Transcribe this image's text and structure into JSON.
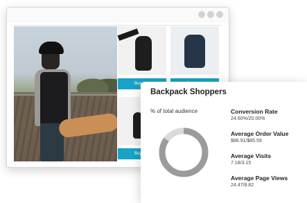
{
  "window": {
    "controls": [
      "minimize",
      "maximize",
      "close"
    ]
  },
  "products": {
    "buy_label": "Buy",
    "items": [
      {
        "image": "black-backpack-held"
      },
      {
        "image": "navy-backpack"
      },
      {
        "image": "black-backpack-small"
      }
    ]
  },
  "panel": {
    "title": "Backpack Shoppers",
    "subtitle": "% of total audience",
    "donut": {
      "share": 0.85,
      "color": "#9b9b9b",
      "track": "#dadada"
    },
    "metrics": [
      {
        "label": "Conversion Rate",
        "value": "24.60%/20.00%"
      },
      {
        "label": "Average Order Value",
        "value": "$86.91/$85.59"
      },
      {
        "label": "Average Visits",
        "value": "7.18/3.15"
      },
      {
        "label": "Average Page Views",
        "value": "24.47/8.82"
      }
    ]
  },
  "colors": {
    "buy_button": "#19a3c7"
  }
}
